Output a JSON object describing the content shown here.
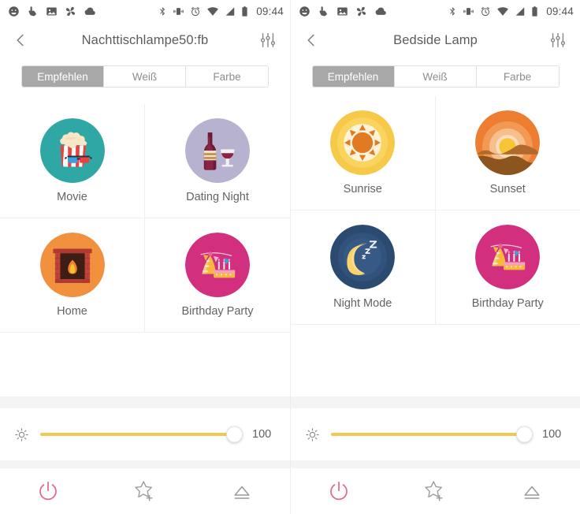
{
  "panels": [
    {
      "statusbar": {
        "icons": [
          "emoji-icon",
          "touch-icon",
          "image-icon",
          "pinwheel-icon",
          "cloud-icon"
        ],
        "right_icons": [
          "bluetooth-icon",
          "vibrate-icon",
          "alarm-icon",
          "wifi-icon",
          "signal-icon",
          "battery-icon"
        ],
        "time": "09:44"
      },
      "title": "Nachttischlampe50:fb",
      "back_icon": "back-chevron-icon",
      "tune_icon": "tune-sliders-icon",
      "tabs": [
        {
          "label": "Empfehlen",
          "active": true
        },
        {
          "label": "Weiß",
          "active": false
        },
        {
          "label": "Farbe",
          "active": false
        }
      ],
      "scenes": [
        {
          "label": "Movie",
          "icon": "movie-popcorn-icon",
          "color": "#2fa7a4"
        },
        {
          "label": "Dating Night",
          "icon": "wine-bottle-glass-icon",
          "color": "#b7b2cf"
        },
        {
          "label": "Home",
          "icon": "fireplace-icon",
          "color": "#f2913d"
        },
        {
          "label": "Birthday Party",
          "icon": "birthday-cake-icon",
          "color": "#d32f7f"
        }
      ],
      "brightness": {
        "icon": "brightness-sun-icon",
        "value": "100",
        "percent": 100,
        "color": "#f3c752"
      },
      "bottom": [
        {
          "icon": "power-icon",
          "color": "#e36b86"
        },
        {
          "icon": "star-plus-icon",
          "color": "#8a8a8a"
        },
        {
          "icon": "eject-icon",
          "color": "#8a8a8a"
        }
      ]
    },
    {
      "statusbar": {
        "icons": [
          "emoji-icon",
          "touch-icon",
          "image-icon",
          "pinwheel-icon",
          "cloud-icon"
        ],
        "right_icons": [
          "bluetooth-icon",
          "vibrate-icon",
          "alarm-icon",
          "wifi-icon",
          "signal-icon",
          "battery-icon"
        ],
        "time": "09:44"
      },
      "title": "Bedside Lamp",
      "back_icon": "back-chevron-icon",
      "tune_icon": "tune-sliders-icon",
      "tabs": [
        {
          "label": "Empfehlen",
          "active": true
        },
        {
          "label": "Weiß",
          "active": false
        },
        {
          "label": "Farbe",
          "active": false
        }
      ],
      "scenes": [
        {
          "label": "Sunrise",
          "icon": "sunrise-icon",
          "color": "#f7c948"
        },
        {
          "label": "Sunset",
          "icon": "sunset-icon",
          "color": "#ed7d31"
        },
        {
          "label": "Night Mode",
          "icon": "night-moon-icon",
          "color": "#2b4a70"
        },
        {
          "label": "Birthday Party",
          "icon": "birthday-cake-icon",
          "color": "#d32f7f"
        }
      ],
      "brightness": {
        "icon": "brightness-sun-icon",
        "value": "100",
        "percent": 100,
        "color": "#f3c752"
      },
      "bottom": [
        {
          "icon": "power-icon",
          "color": "#e36b86"
        },
        {
          "icon": "star-plus-icon",
          "color": "#8a8a8a"
        },
        {
          "icon": "eject-icon",
          "color": "#8a8a8a"
        }
      ]
    }
  ]
}
